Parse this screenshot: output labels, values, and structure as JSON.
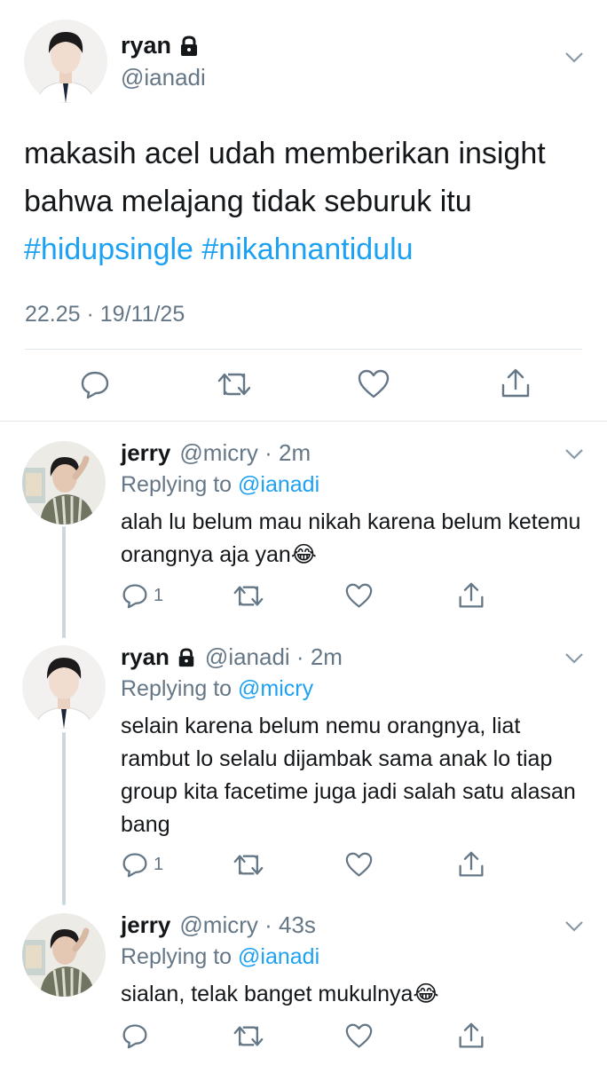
{
  "colors": {
    "accent": "#1da1f2",
    "secondary_text": "#657786",
    "divider": "#e1e8ed",
    "thread_line": "#ccd6dd"
  },
  "main_tweet": {
    "name": "ryan",
    "handle": "@ianadi",
    "text_before": "makasih acel udah memberikan insight bahwa melajang tidak seburuk itu ",
    "hashtag_1": "#hidupsingle",
    "hashtag_2": "#nikahnantidulu",
    "timestamp": "22.25 · 19/11/25",
    "icons": [
      "reply-icon",
      "retweet-icon",
      "like-icon",
      "share-icon"
    ]
  },
  "replies": [
    {
      "name": "jerry",
      "handle_time": "@micry · 2m",
      "replying_label": "Replying to",
      "replying_to": "@ianadi",
      "text": "alah lu belum mau nikah karena belum ketemu orangnya aja yan😂",
      "reply_count": "1"
    },
    {
      "name": "ryan",
      "handle_time": "@ianadi · 2m",
      "replying_label": "Replying to",
      "replying_to": "@micry",
      "text": "selain karena belum nemu orangnya, liat rambut lo selalu dijambak sama anak lo tiap group kita facetime juga jadi salah satu alasan bang",
      "reply_count": "1"
    },
    {
      "name": "jerry",
      "handle_time": "@micry · 43s",
      "replying_label": "Replying to",
      "replying_to": "@ianadi",
      "text": "sialan, telak banget mukulnya😂",
      "reply_count": ""
    }
  ]
}
